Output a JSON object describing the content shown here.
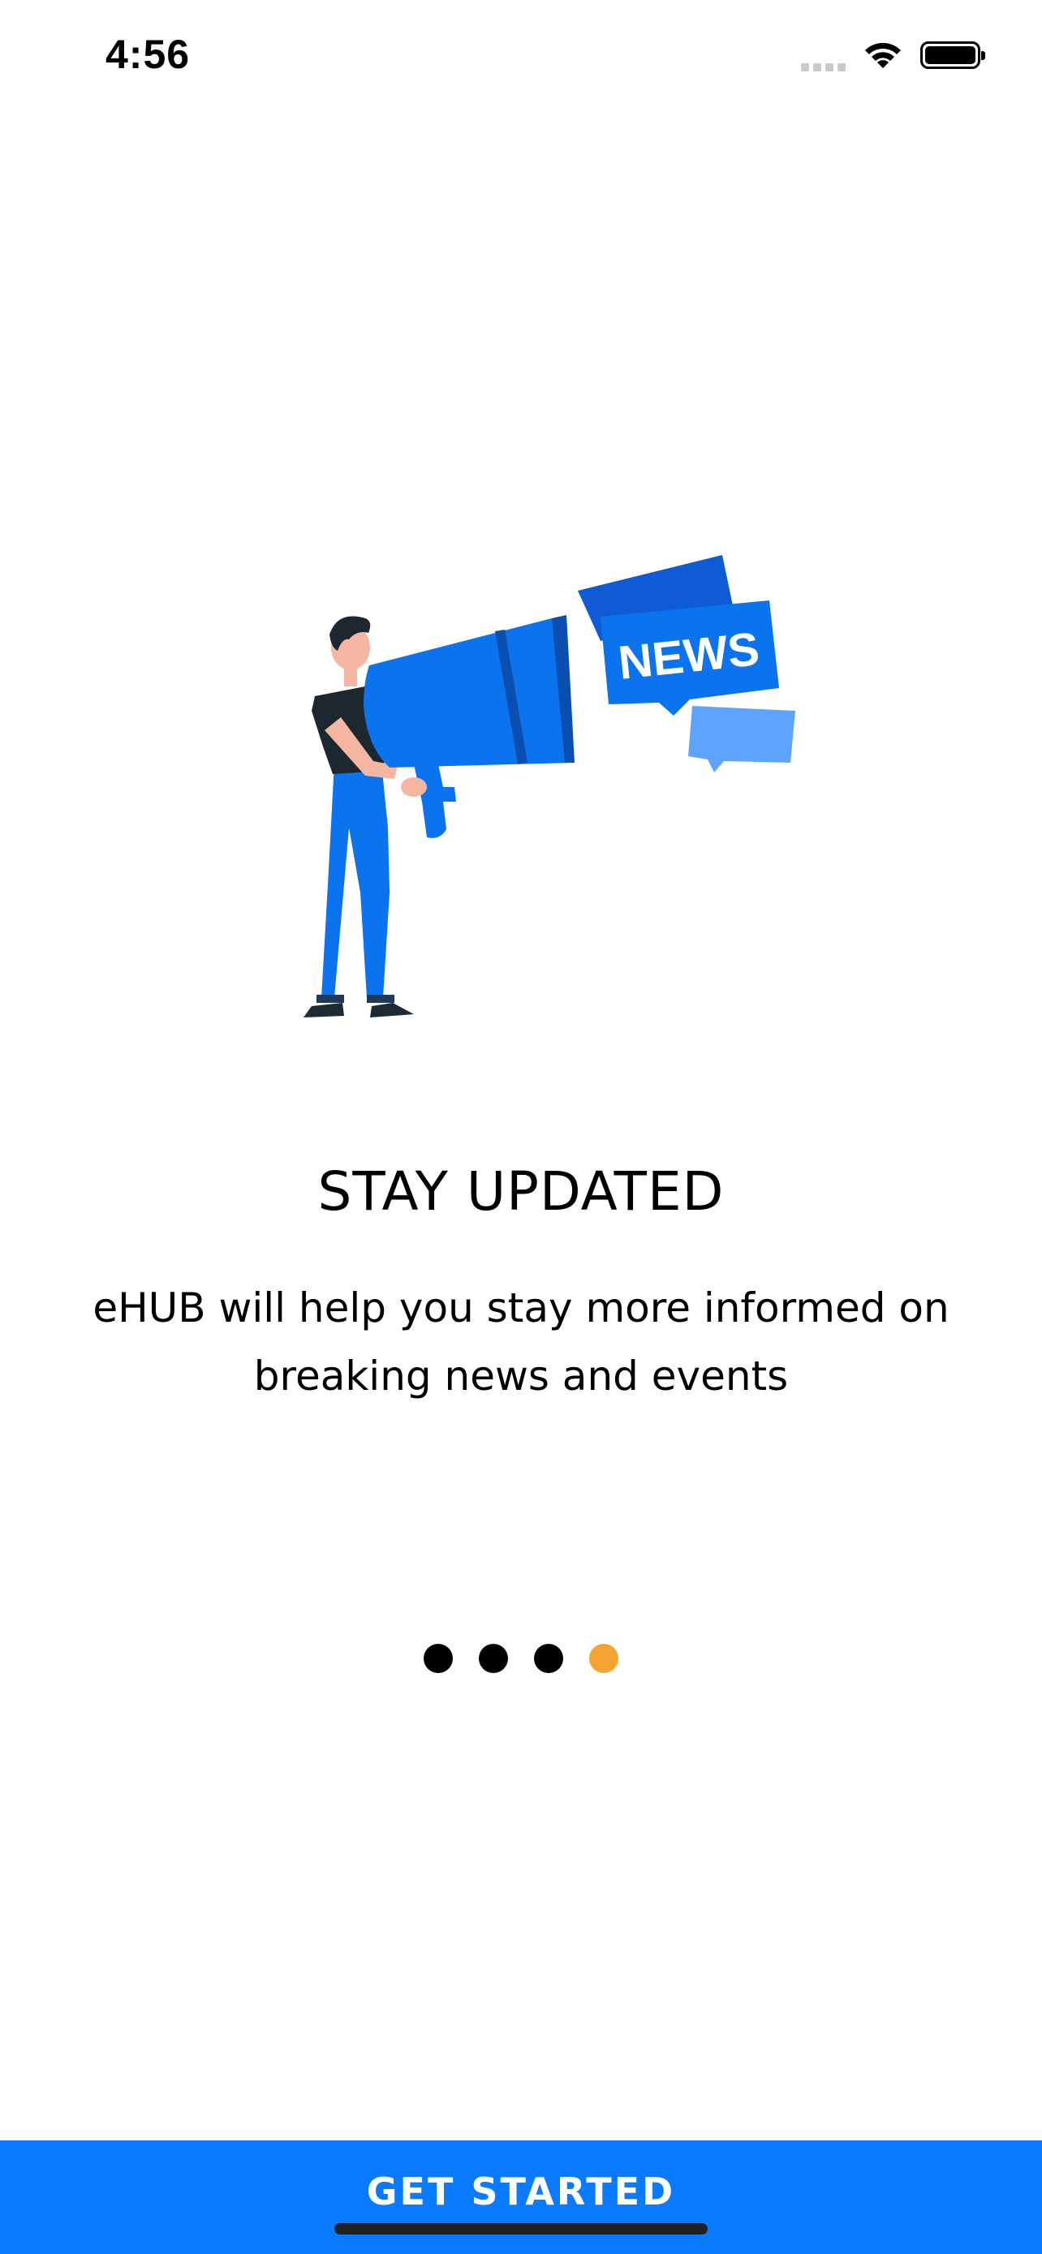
{
  "status_bar": {
    "time": "4:56"
  },
  "onboarding": {
    "illustration_text": "NEWS",
    "title": "STAY UPDATED",
    "description": "eHUB will help you stay more informed on breaking news and events",
    "page_indicator": {
      "total": 4,
      "current": 4,
      "active_color": "#f5a332",
      "inactive_color": "#000000"
    }
  },
  "cta": {
    "label": "GET STARTED",
    "color": "#0a7bff"
  }
}
